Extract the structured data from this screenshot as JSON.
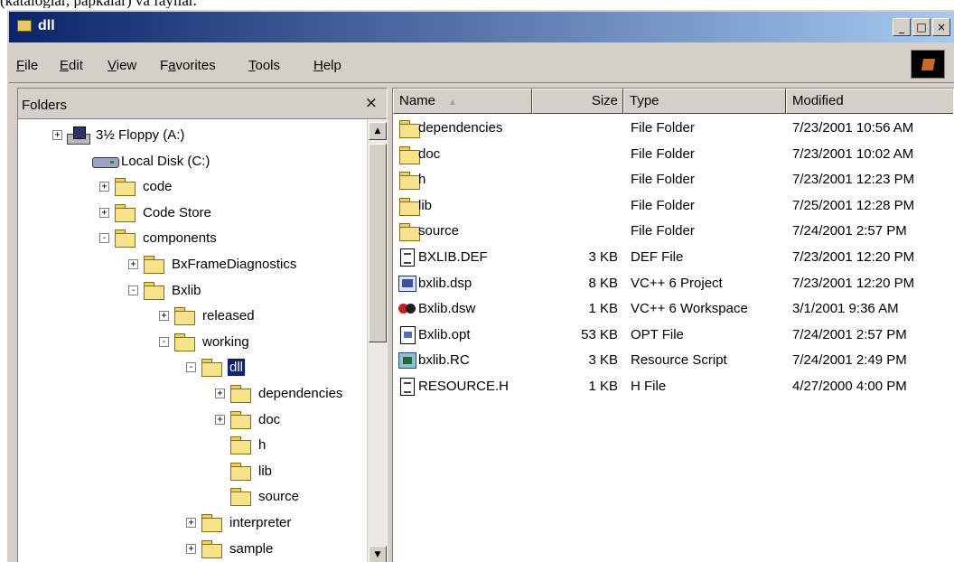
{
  "caption": "(kataloglar, papkalar) va fayllar.",
  "window": {
    "title": "dll",
    "icon": "folder-icon",
    "controls": [
      "minimize-icon",
      "maximize-icon",
      "close-icon"
    ]
  },
  "menu": [
    {
      "mnemonic": "F",
      "rest": "ile"
    },
    {
      "mnemonic": "E",
      "rest": "dit"
    },
    {
      "mnemonic": "V",
      "rest": "iew"
    },
    {
      "pre": "F",
      "mnemonic": "a",
      "rest": "vorites"
    },
    {
      "mnemonic": "T",
      "rest": "ools"
    },
    {
      "mnemonic": "H",
      "rest": "elp"
    }
  ],
  "folders": {
    "title": "Folders",
    "close": "×",
    "tree": [
      {
        "label": "3½ Floppy (A:)",
        "icon": "floppy-icon",
        "expander": "+"
      },
      {
        "label": "Local Disk (C:)",
        "icon": "hard-disk-icon",
        "expander": ""
      },
      {
        "label": "code",
        "icon": "folder-icon",
        "expander": "+"
      },
      {
        "label": "Code Store",
        "icon": "folder-icon",
        "expander": "+"
      },
      {
        "label": "components",
        "icon": "folder-icon",
        "expander": "-"
      },
      {
        "label": "BxFrameDiagnostics",
        "icon": "folder-icon",
        "expander": "+"
      },
      {
        "label": "Bxlib",
        "icon": "folder-icon",
        "expander": "-"
      },
      {
        "label": "released",
        "icon": "folder-icon",
        "expander": "+"
      },
      {
        "label": "working",
        "icon": "folder-icon",
        "expander": "-"
      },
      {
        "label": "dll",
        "icon": "open-folder-icon",
        "expander": "-",
        "selected": true
      },
      {
        "label": "dependencies",
        "icon": "folder-icon",
        "expander": "+"
      },
      {
        "label": "doc",
        "icon": "folder-icon",
        "expander": "+"
      },
      {
        "label": "h",
        "icon": "folder-icon",
        "expander": ""
      },
      {
        "label": "lib",
        "icon": "folder-icon",
        "expander": ""
      },
      {
        "label": "source",
        "icon": "folder-icon",
        "expander": ""
      },
      {
        "label": "interpreter",
        "icon": "folder-icon",
        "expander": "+"
      },
      {
        "label": "sample",
        "icon": "folder-icon",
        "expander": "+"
      }
    ]
  },
  "columns": {
    "name": "Name",
    "size": "Size",
    "type": "Type",
    "modified": "Modified",
    "sort_indicator": "▲"
  },
  "files": [
    {
      "name": "dependencies",
      "size": "",
      "type": "File Folder",
      "modified": "7/23/2001 10:56 AM",
      "icon": "folder-icon"
    },
    {
      "name": "doc",
      "size": "",
      "type": "File Folder",
      "modified": "7/23/2001 10:02 AM",
      "icon": "folder-icon"
    },
    {
      "name": "h",
      "size": "",
      "type": "File Folder",
      "modified": "7/23/2001 12:23 PM",
      "icon": "folder-icon"
    },
    {
      "name": "lib",
      "size": "",
      "type": "File Folder",
      "modified": "7/25/2001 12:28 PM",
      "icon": "folder-icon"
    },
    {
      "name": "source",
      "size": "",
      "type": "File Folder",
      "modified": "7/24/2001 2:57 PM",
      "icon": "folder-icon"
    },
    {
      "name": "BXLIB.DEF",
      "size": "3 KB",
      "type": "DEF File",
      "modified": "7/23/2001 12:20 PM",
      "icon": "text-file-icon"
    },
    {
      "name": "bxlib.dsp",
      "size": "8 KB",
      "type": "VC++ 6 Project",
      "modified": "7/23/2001 12:20 PM",
      "icon": "vc-project-icon"
    },
    {
      "name": "Bxlib.dsw",
      "size": "1 KB",
      "type": "VC++ 6 Workspace",
      "modified": "3/1/2001 9:36 AM",
      "icon": "vc-workspace-icon"
    },
    {
      "name": "Bxlib.opt",
      "size": "53 KB",
      "type": "OPT File",
      "modified": "7/24/2001 2:57 PM",
      "icon": "opt-file-icon"
    },
    {
      "name": "bxlib.RC",
      "size": "3 KB",
      "type": "Resource Script",
      "modified": "7/24/2001 2:49 PM",
      "icon": "resource-script-icon"
    },
    {
      "name": "RESOURCE.H",
      "size": "1 KB",
      "type": "H File",
      "modified": "4/27/2000 4:00 PM",
      "icon": "text-file-icon"
    }
  ]
}
